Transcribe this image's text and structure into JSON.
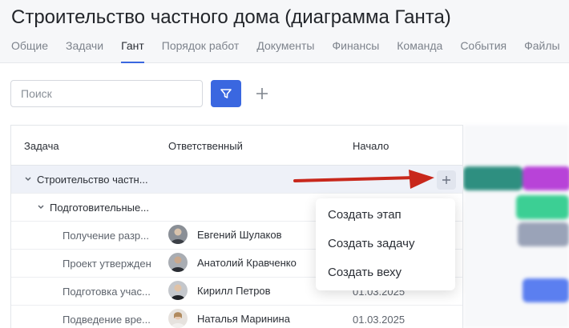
{
  "page": {
    "title": "Строительство частного дома (диаграмма Ганта)"
  },
  "tabs": [
    {
      "label": "Общие"
    },
    {
      "label": "Задачи"
    },
    {
      "label": "Гант",
      "active": true
    },
    {
      "label": "Порядок работ"
    },
    {
      "label": "Документы"
    },
    {
      "label": "Финансы"
    },
    {
      "label": "Команда"
    },
    {
      "label": "События"
    },
    {
      "label": "Файлы"
    }
  ],
  "toolbar": {
    "search_placeholder": "Поиск",
    "filter_icon": "filter-icon",
    "add_icon": "plus-icon"
  },
  "table": {
    "headers": {
      "task": "Задача",
      "assignee": "Ответственный",
      "start": "Начало"
    },
    "rows": [
      {
        "task": "Строительство частн...",
        "level": 0,
        "expanded": true,
        "assignee": "",
        "start": ""
      },
      {
        "task": "Подготовительные...",
        "level": 1,
        "expanded": true,
        "assignee": "",
        "start": ""
      },
      {
        "task": "Получение разр...",
        "level": 2,
        "assignee": "Евгений Шулаков",
        "start": ""
      },
      {
        "task": "Проект утвержден",
        "level": 2,
        "assignee": "Анатолий Кравченко",
        "start": ""
      },
      {
        "task": "Подготовка учас...",
        "level": 2,
        "assignee": "Кирилл Петров",
        "start": "01.03.2025"
      },
      {
        "task": "Подведение вре...",
        "level": 2,
        "assignee": "Наталья Маринина",
        "start": "01.03.2025"
      }
    ]
  },
  "context_menu": {
    "items": [
      {
        "label": "Создать этап"
      },
      {
        "label": "Создать задачу"
      },
      {
        "label": "Создать веху"
      }
    ]
  },
  "colors": {
    "accent": "#3a67e0",
    "arrow": "#c8281c",
    "gantt_bars": [
      "#2e8f80",
      "#b843d8",
      "#3ccf94",
      "#9aa3b8",
      "#5b7ff0"
    ]
  }
}
